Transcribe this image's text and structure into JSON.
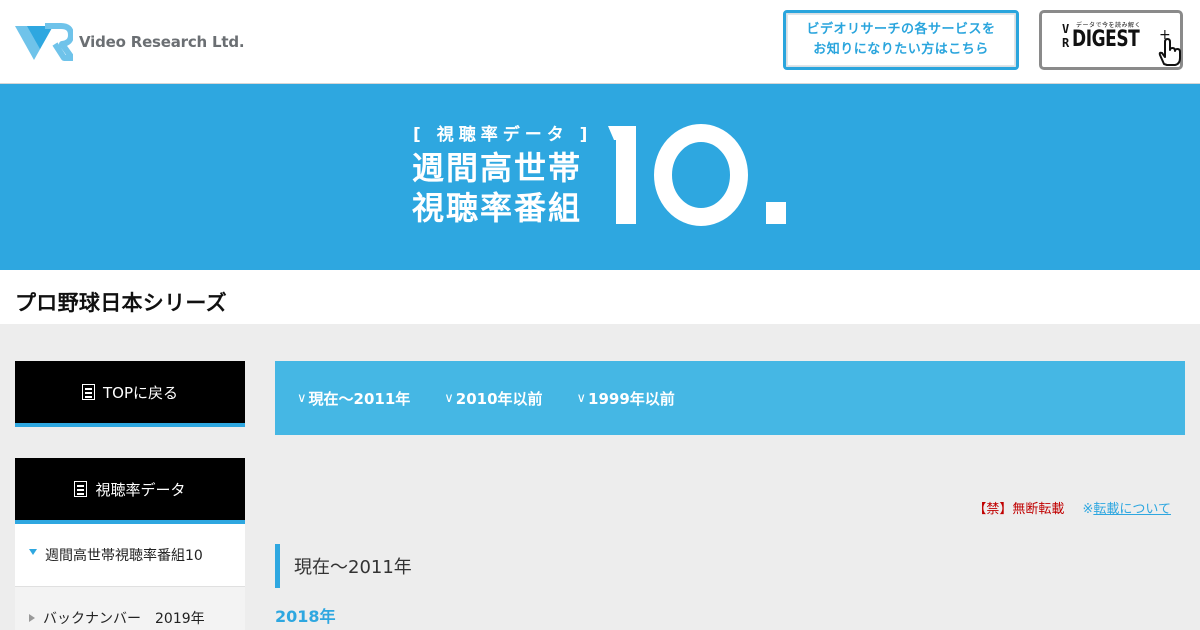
{
  "header": {
    "logo_text": "Video Research Ltd.",
    "service_button": {
      "line1": "ビデオリサーチの各サービスを",
      "line2": "お知りになりたい方はこちら"
    },
    "digest_button": {
      "vr_v": "V",
      "vr_r": "R",
      "tagline": "データで今を読み解く",
      "word": "DIGEST"
    }
  },
  "hero": {
    "bracket_title": "[ 視聴率データ ]",
    "line1": "週間高世帯",
    "line2": "視聴率番組",
    "number": "10."
  },
  "page_title": "プロ野球日本シリーズ",
  "sidebar": {
    "top_label": "TOPに戻る",
    "data_label": "視聴率データ",
    "items": [
      {
        "label": "週間高世帯視聴率番組10"
      },
      {
        "label": "バックナンバー　2019年"
      }
    ]
  },
  "tabs": [
    {
      "label": "現在〜2011年"
    },
    {
      "label": "2010年以前"
    },
    {
      "label": "1999年以前"
    }
  ],
  "notice": {
    "prohibited": "【禁】無断転載",
    "mark": "※",
    "link_text": "転載について"
  },
  "section": {
    "heading": "現在〜2011年",
    "year": "2018年"
  },
  "colors": {
    "accent": "#2ea7e0",
    "tab_bar": "#45b7e4",
    "warning": "#c00000"
  }
}
